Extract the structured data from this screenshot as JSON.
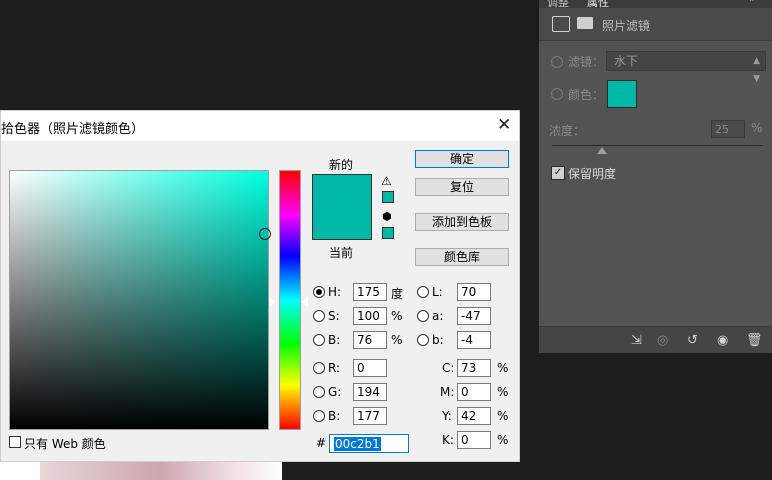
{
  "panel": {
    "tabs": [
      "调整",
      "属性"
    ],
    "header": "照片滤镜",
    "filter_label": "滤镜：",
    "filter_value": "水下",
    "color_label": "颜色：",
    "density_label": "浓度：",
    "density_value": "25",
    "density_unit": "%",
    "preserve_label": "保留明度",
    "swatch_color": "#00b8a6"
  },
  "dialog": {
    "title": "拾色器（照片滤镜颜色）",
    "new_label": "新的",
    "current_label": "当前",
    "buttons": {
      "ok": "确定",
      "reset": "复位",
      "add_to_swatches": "添加到色板",
      "color_libraries": "颜色库"
    },
    "hsb": {
      "h_label": "H:",
      "h": "175",
      "h_unit": "度",
      "s_label": "S:",
      "s": "100",
      "s_unit": "%",
      "b_label": "B:",
      "b": "76",
      "b_unit": "%"
    },
    "lab": {
      "l_label": "L:",
      "l": "70",
      "a_label": "a:",
      "a": "-47",
      "b_label": "b:",
      "b": "-4"
    },
    "rgb": {
      "r_label": "R:",
      "r": "0",
      "g_label": "G:",
      "g": "194",
      "b_label": "B:",
      "b": "177"
    },
    "cmyk": {
      "c_label": "C:",
      "c": "73",
      "m_label": "M:",
      "m": "0",
      "y_label": "Y:",
      "y": "42",
      "k_label": "K:",
      "k": "0",
      "unit": "%"
    },
    "hex_label": "#",
    "hex": "00c2b1",
    "web_only_label": "只有 Web 颜色",
    "color": "#00b8a6"
  }
}
